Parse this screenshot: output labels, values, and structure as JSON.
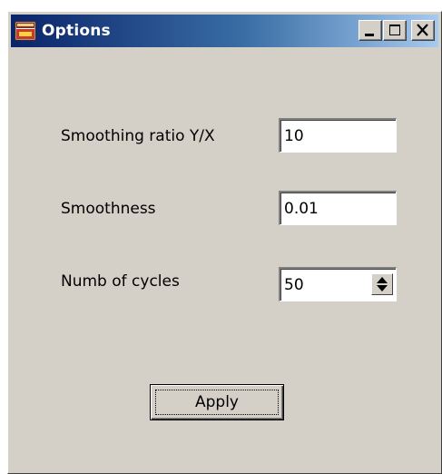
{
  "window": {
    "title": "Options",
    "icon": "application-icon",
    "controls": [
      "minimize-icon",
      "maximize-icon",
      "close-icon"
    ]
  },
  "form": {
    "smoothing_ratio": {
      "label": "Smoothing ratio Y/X",
      "value": "10"
    },
    "smoothness": {
      "label": "Smoothness",
      "value": "0.01"
    },
    "cycles": {
      "label": "Numb of cycles",
      "value": "50"
    }
  },
  "apply_button": {
    "label": "Apply"
  },
  "colors": {
    "face": "#d4d0c8",
    "title_start": "#0a246a",
    "title_end": "#a6caf0",
    "title_text": "#ffffff"
  }
}
